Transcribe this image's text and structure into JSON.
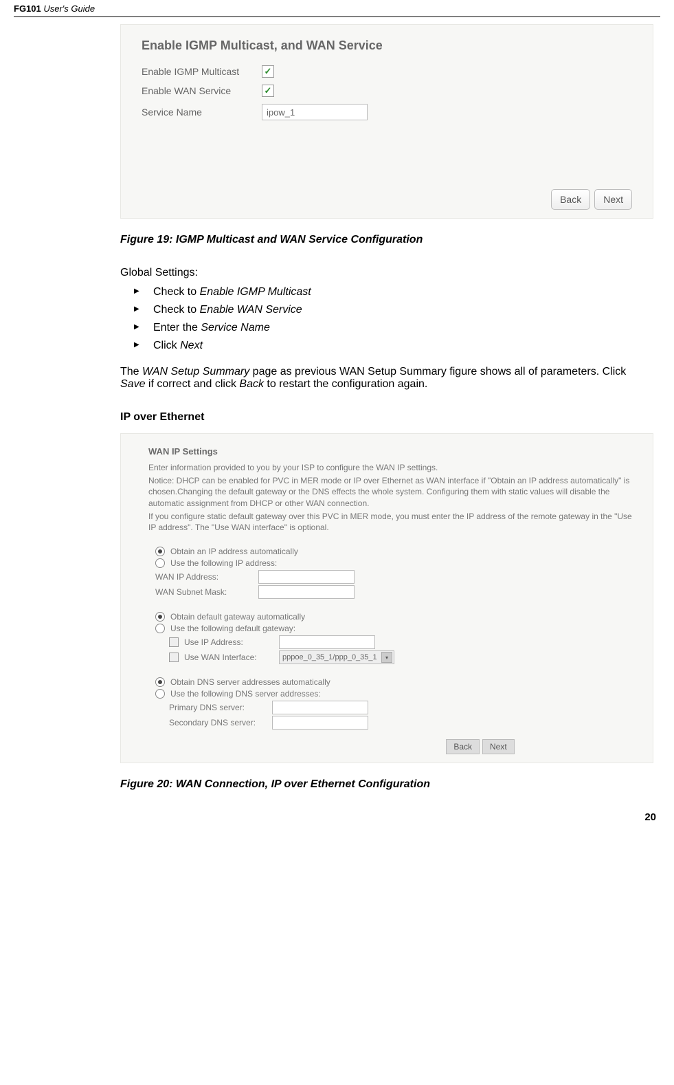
{
  "header": {
    "product": "FG101",
    "suffix": " User's Guide"
  },
  "panel1": {
    "title": "Enable IGMP Multicast, and WAN Service",
    "rows": {
      "igmp_label": "Enable IGMP Multicast",
      "wan_label": "Enable WAN Service",
      "svc_label": "Service Name",
      "svc_value": "ipow_1"
    },
    "buttons": {
      "back": "Back",
      "next": "Next"
    }
  },
  "fig19": "Figure 19: IGMP Multicast and WAN Service Configuration",
  "global_heading": "Global Settings:",
  "bullets": {
    "b1a": "Check to ",
    "b1b": "Enable IGMP Multicast",
    "b2a": "Check to ",
    "b2b": "Enable WAN Service",
    "b3a": "Enter the ",
    "b3b": "Service Name",
    "b4a": "Click ",
    "b4b": "Next"
  },
  "para": {
    "t1": "The ",
    "t2": "WAN Setup Summary",
    "t3": " page as previous WAN Setup Summary figure shows all of parameters. Click ",
    "t4": "Save",
    "t5": " if correct and click ",
    "t6": "Back",
    "t7": " to restart the configuration again."
  },
  "ipoe_heading": "IP over Ethernet",
  "panel2": {
    "title": "WAN IP Settings",
    "intro1": "Enter information provided to you by your ISP to configure the WAN IP settings.",
    "intro2": "Notice: DHCP can be enabled for PVC in MER mode or IP over Ethernet as WAN interface if \"Obtain an IP address automatically\" is chosen.Changing the default gateway or the DNS effects the whole system. Configuring them with static values will disable the automatic assignment from DHCP or other WAN connection.",
    "intro3": "If you configure static default gateway over this PVC in MER mode, you must enter the IP address of the remote gateway in the \"Use IP address\". The \"Use WAN interface\" is optional.",
    "ip": {
      "auto": "Obtain an IP address automatically",
      "manual": "Use the following IP address:",
      "addr_label": "WAN IP Address:",
      "mask_label": "WAN Subnet Mask:"
    },
    "gw": {
      "auto": "Obtain default gateway automatically",
      "manual": "Use the following default gateway:",
      "use_ip": "Use IP Address:",
      "use_wan": "Use WAN Interface:",
      "wan_value": "pppoe_0_35_1/ppp_0_35_1"
    },
    "dns": {
      "auto": "Obtain DNS server addresses automatically",
      "manual": "Use the following DNS server addresses:",
      "primary": "Primary DNS server:",
      "secondary": "Secondary DNS server:"
    },
    "buttons": {
      "back": "Back",
      "next": "Next"
    }
  },
  "fig20": "Figure 20: WAN Connection, IP over Ethernet Configuration",
  "page_number": "20"
}
